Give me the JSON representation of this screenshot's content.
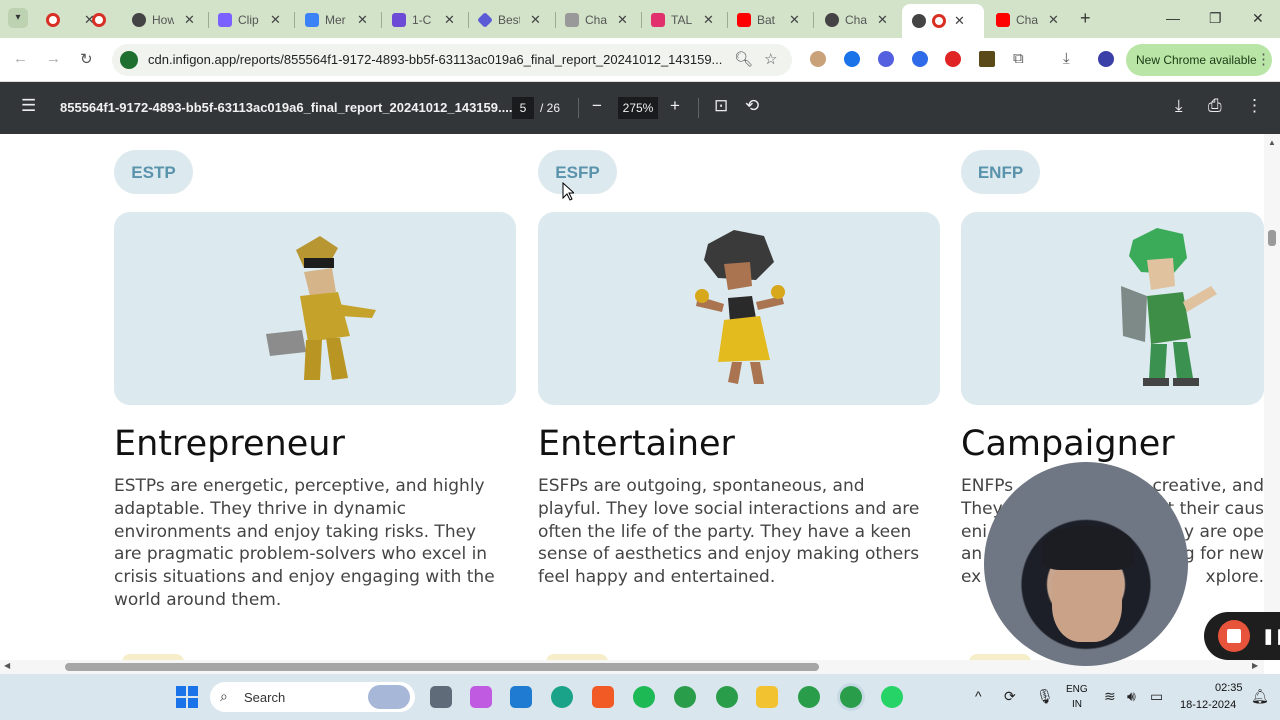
{
  "browser": {
    "tabs": [
      {
        "title": "",
        "favicon_color": "#d93025"
      },
      {
        "title": "",
        "favicon_color": "#d93025"
      },
      {
        "title": "How",
        "favicon_color": "#444444"
      },
      {
        "title": "Clip",
        "favicon_color": "#7b61ff"
      },
      {
        "title": "Mer",
        "favicon_color": "#3b82f6"
      },
      {
        "title": "1-C",
        "favicon_color": "#6c4bd6"
      },
      {
        "title": "Best",
        "favicon_color": "#5b5bd6"
      },
      {
        "title": "Cha",
        "favicon_color": "#777777"
      },
      {
        "title": "TAL",
        "favicon_color": "#e1306c"
      },
      {
        "title": "Bat",
        "favicon_color": "#ff0000"
      },
      {
        "title": "Cha",
        "favicon_color": "#444444"
      },
      {
        "title": "",
        "favicon_color": "#d93025",
        "active": true
      },
      {
        "title": "Cha",
        "favicon_color": "#ff0000"
      }
    ],
    "url": "cdn.infigon.app/reports/855564f1-9172-4893-bb5f-63113ac019a6_final_report_20241012_143159...",
    "new_chrome_label": "New Chrome available"
  },
  "pdf": {
    "title": "855564f1-9172-4893-bb5f-63113ac019a6_final_report_20241012_143159....",
    "page_current": "5",
    "page_total": "/ 26",
    "zoom": "275%"
  },
  "profiles": [
    {
      "code": "ESTP",
      "name": "Entrepreneur",
      "description": "ESTPs are energetic, perceptive, and highly adaptable. They thrive in dynamic environments and enjoy taking risks. They are pragmatic problem-solvers who excel in crisis situations and enjoy engaging with the world around them."
    },
    {
      "code": "ESFP",
      "name": "Entertainer",
      "description": "ESFPs are outgoing, spontaneous, and playful. They love social interactions and are often the life of the party. They have a keen sense of aesthetics and enjoy making others feel happy and entertained."
    },
    {
      "code": "ENFP",
      "name": "Campaigner",
      "description_lines": [
        "ENFPs",
        "They",
        "eni",
        "an",
        "ex"
      ],
      "description_fragments": [
        "creative, and",
        "t their caus",
        "y are ope",
        "g for new",
        "xplore."
      ]
    }
  ],
  "taskbar": {
    "search_label": "Search",
    "lang_top": "ENG",
    "lang_bottom": "IN",
    "time": "02:35",
    "date": "18-12-2024"
  }
}
